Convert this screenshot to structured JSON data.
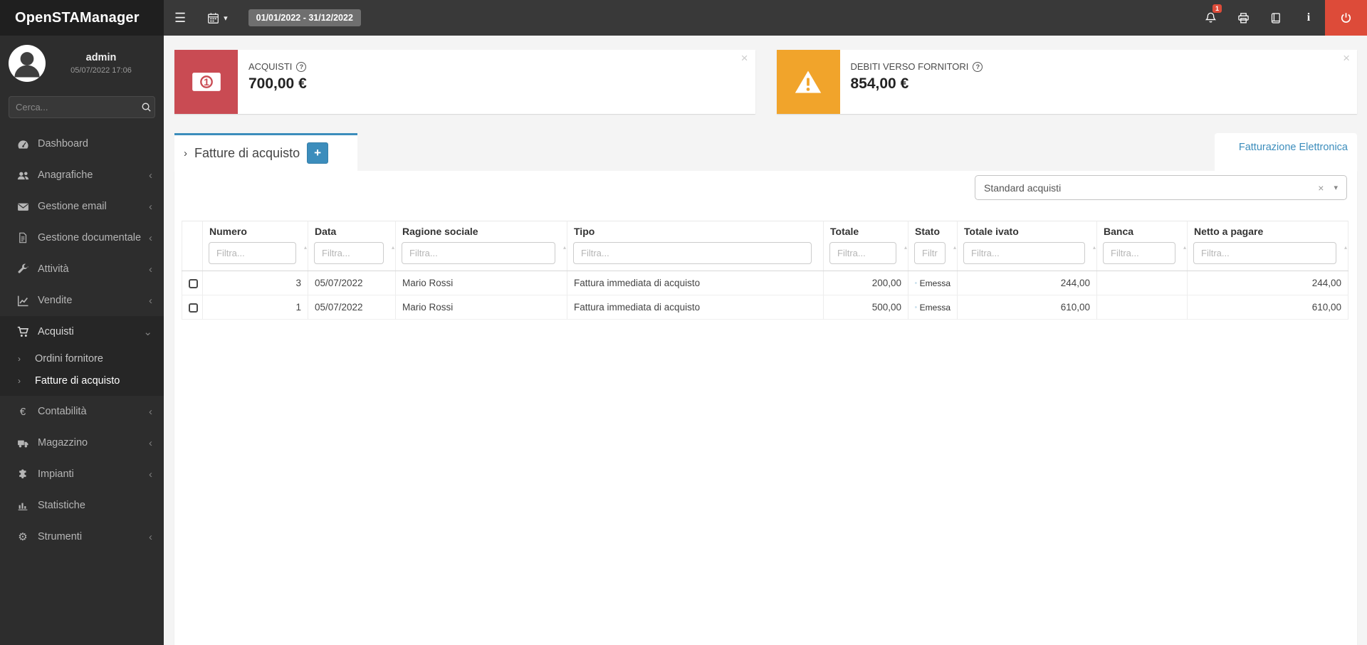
{
  "topbar": {
    "brand": "OpenSTAManager",
    "date_range": "01/01/2022 - 31/12/2022",
    "notification_count": "1"
  },
  "sidebar": {
    "user": {
      "name": "admin",
      "datetime": "05/07/2022 17:06"
    },
    "search_placeholder": "Cerca...",
    "items": [
      {
        "label": "Dashboard"
      },
      {
        "label": "Anagrafiche"
      },
      {
        "label": "Gestione email"
      },
      {
        "label": "Gestione documentale"
      },
      {
        "label": "Attività"
      },
      {
        "label": "Vendite"
      },
      {
        "label": "Acquisti"
      },
      {
        "label": "Contabilità"
      },
      {
        "label": "Magazzino"
      },
      {
        "label": "Impianti"
      },
      {
        "label": "Statistiche"
      },
      {
        "label": "Strumenti"
      }
    ],
    "acquisti_submenu": [
      {
        "label": "Ordini fornitore"
      },
      {
        "label": "Fatture di acquisto"
      }
    ]
  },
  "cards": [
    {
      "title": "ACQUISTI",
      "value": "700,00 €",
      "accent": "#c94b53"
    },
    {
      "title": "DEBITI VERSO FORNITORI",
      "value": "854,00 €",
      "accent": "#f1a42b"
    }
  ],
  "tabs": {
    "active_label": "Fatture di acquisto",
    "right_link": "Fatturazione Elettronica"
  },
  "filter_select": {
    "value": "Standard acquisti"
  },
  "table": {
    "columns": [
      "Numero",
      "Data",
      "Ragione sociale",
      "Tipo",
      "Totale",
      "Stato",
      "Totale ivato",
      "Banca",
      "Netto a pagare"
    ],
    "filter_placeholder": "Filtra...",
    "rows": [
      {
        "numero": "3",
        "data": "05/07/2022",
        "ragione_sociale": "Mario Rossi",
        "tipo": "Fattura immediata di acquisto",
        "totale": "200,00",
        "stato": "Emessa",
        "totale_ivato": "244,00",
        "banca": "",
        "netto_a_pagare": "244,00"
      },
      {
        "numero": "1",
        "data": "05/07/2022",
        "ragione_sociale": "Mario Rossi",
        "tipo": "Fattura immediata di acquisto",
        "totale": "500,00",
        "stato": "Emessa",
        "totale_ivato": "610,00",
        "banca": "",
        "netto_a_pagare": "610,00"
      }
    ]
  },
  "icons": {
    "hamburger": "☰",
    "caret_down": "▾",
    "chevron_left": "‹",
    "chevron_right": "›",
    "chevron_down": "⌄",
    "close": "×",
    "plus": "+",
    "euro": "€",
    "gear": "⚙",
    "info": "i",
    "question": "?",
    "sort_up": "▴",
    "sort_down": "▾",
    "select_clear": "×"
  },
  "colors": {
    "accent_blue": "#3c8dbc",
    "topbar": "#393939",
    "sidebar": "#2d2d2d",
    "danger_red": "#dd4b39",
    "card_red": "#c94b53",
    "card_yellow": "#f1a42b"
  }
}
